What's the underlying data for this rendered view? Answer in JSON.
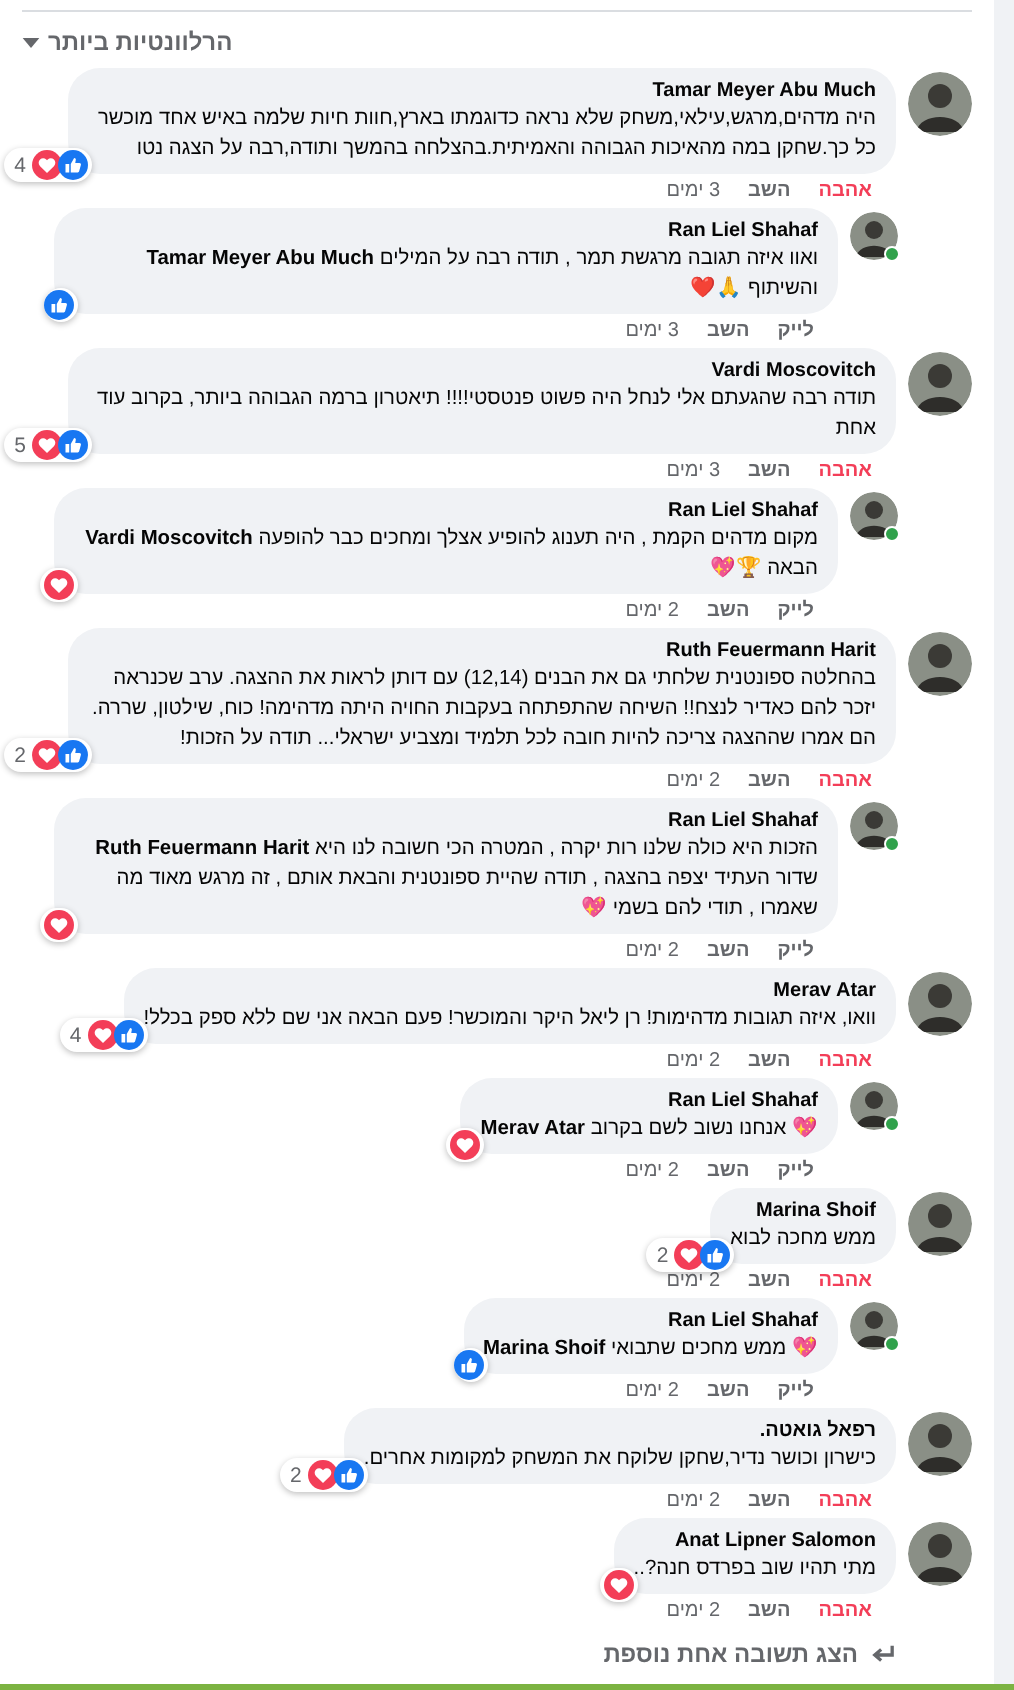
{
  "sort": {
    "label": "הרלוונטיות ביותר"
  },
  "comments": [
    {
      "author": "Tamar Meyer Abu Much",
      "online": false,
      "text": "היה מדהים,מרגש,עילאי,משחק שלא נראה כדוגמתו בארץ,חוות חיות שלמה באיש אחד מוכשר כל כך.שחקן במה מהאיכות הגבוהה והאמיתית.בהצלחה בהמשך ותודה,רבה על הצגה נטו",
      "reactions": {
        "count": "4",
        "love": true,
        "like": true
      },
      "react_label": "אהבה",
      "reacted": true,
      "reply_label": "השב",
      "time": "3 ימים",
      "children": [
        {
          "author": "Ran Liel Shahaf",
          "online": true,
          "text": "ואוו איזה תגובה מרגשת תמר , תודה רבה על המילים **Tamar Meyer Abu Much** והשיתוף 🙏❤️",
          "reactions": {
            "love": false,
            "like": true
          },
          "react_label": "לייק",
          "reacted": false,
          "reply_label": "השב",
          "time": "3 ימים"
        }
      ]
    },
    {
      "author": "Vardi Moscovitch",
      "online": false,
      "text": "תודה רבה שהגעתם אלי לנחל היה פשוט פנטסטי!!!! תיאטרון ברמה הגבוהה ביותר, בקרוב עוד אחת",
      "reactions": {
        "count": "5",
        "love": true,
        "like": true
      },
      "react_label": "אהבה",
      "reacted": true,
      "reply_label": "השב",
      "time": "3 ימים",
      "children": [
        {
          "author": "Ran Liel Shahaf",
          "online": true,
          "text": "מקום מדהים הקמת , היה תענוג להופיע אצלך ומחכים כבר להופעה **Vardi Moscovitch** הבאה 🏆💖",
          "reactions": {
            "love": true,
            "like": false
          },
          "react_label": "לייק",
          "reacted": false,
          "reply_label": "השב",
          "time": "2 ימים"
        }
      ]
    },
    {
      "author": "Ruth Feuermann Harit",
      "online": false,
      "text": "בהחלטה ספונטנית שלחתי גם את הבנים (12,14) עם דותן לראות את ההצגה. ערב שכנראה יזכר להם כאדיר לנצח!! השיחה שהתפתחה בעקבות החויה היתה מדהימה! כוח, שילטון, שררה. הם אמרו שההצגה צריכה להיות חובה לכל תלמיד ומצביע ישראלי... תודה על הזכות!",
      "reactions": {
        "count": "2",
        "love": true,
        "like": true
      },
      "react_label": "אהבה",
      "reacted": true,
      "reply_label": "השב",
      "time": "2 ימים",
      "children": [
        {
          "author": "Ran Liel Shahaf",
          "online": true,
          "text": "הזכות היא כולה שלנו רות יקרה , המטרה הכי חשובה לנו היא **Ruth Feuermann Harit** שדור העתיד יצפה בהצגה , תודה שהיית ספונטנית והבאת אותם , זה מרגש מאוד מה שאמרו , תודי להם בשמי 💖",
          "reactions": {
            "love": true,
            "like": false
          },
          "react_label": "לייק",
          "reacted": false,
          "reply_label": "השב",
          "time": "2 ימים"
        }
      ]
    },
    {
      "author": "Merav Atar",
      "online": false,
      "text": "וואו, איזה תגובות מדהימות! רן ליאל היקר והמוכשר! פעם הבאה אני שם ללא ספק בכלל!",
      "reactions": {
        "count": "4",
        "love": true,
        "like": true
      },
      "react_label": "אהבה",
      "reacted": true,
      "reply_label": "השב",
      "time": "2 ימים",
      "children": [
        {
          "author": "Ran Liel Shahaf",
          "online": true,
          "text": "💖 אנחנו נשוב לשם בקרוב **Merav Atar**",
          "reactions": {
            "love": true,
            "like": false
          },
          "react_label": "לייק",
          "reacted": false,
          "reply_label": "השב",
          "time": "2 ימים"
        }
      ]
    },
    {
      "author": "Marina Shoif",
      "online": false,
      "text": "ממש מחכה לבוא",
      "reactions": {
        "count": "2",
        "love": true,
        "like": true
      },
      "react_label": "אהבה",
      "reacted": true,
      "reply_label": "השב",
      "time": "2 ימים",
      "children": [
        {
          "author": "Ran Liel Shahaf",
          "online": true,
          "text": "💖 ממש מחכים שתבואי **Marina Shoif**",
          "reactions": {
            "love": false,
            "like": true
          },
          "react_label": "לייק",
          "reacted": false,
          "reply_label": "השב",
          "time": "2 ימים"
        }
      ]
    },
    {
      "author": "רפאל גואטה.",
      "online": false,
      "text": "כישרון וכושר נדיר,שחקן שלוקח את המשחק למקומות אחרים.",
      "reactions": {
        "count": "2",
        "love": true,
        "like": true
      },
      "react_label": "אהבה",
      "reacted": true,
      "reply_label": "השב",
      "time": "2 ימים"
    },
    {
      "author": "Anat Lipner Salomon",
      "online": false,
      "text": "מתי תהיו שוב בפרדס חנה?..",
      "reactions": {
        "love": true,
        "like": false
      },
      "react_label": "אהבה",
      "reacted": true,
      "reply_label": "השב",
      "time": "2 ימים"
    }
  ],
  "more_replies": {
    "label": "הצג תשובה אחת נוספת"
  }
}
